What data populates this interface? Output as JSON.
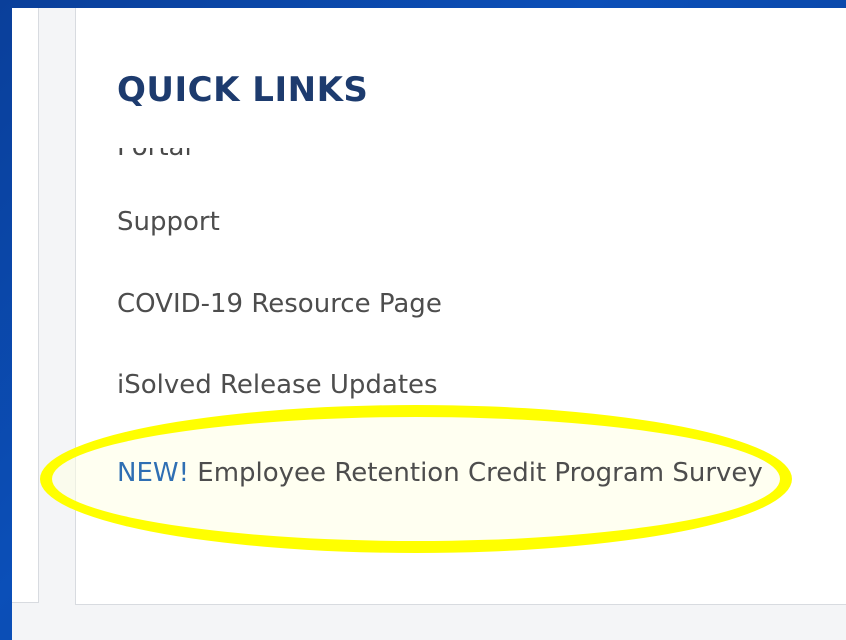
{
  "quick_links": {
    "title": "QUICK LINKS",
    "partially_hidden_item": "Portal",
    "items": [
      {
        "label": "Support"
      },
      {
        "label": "COVID-19 Resource Page"
      },
      {
        "label": "iSolved Release Updates"
      }
    ],
    "featured_item": {
      "tag": "NEW!",
      "label": "Employee Retention Credit Program Survey"
    }
  },
  "annotation": {
    "highlight_color": "#ffff00"
  },
  "colors": {
    "background_blue": "#0b4fb8",
    "title_navy": "#1d3b6e",
    "link_gray": "#4d4d4d",
    "new_tag_blue": "#2f6fb3"
  }
}
